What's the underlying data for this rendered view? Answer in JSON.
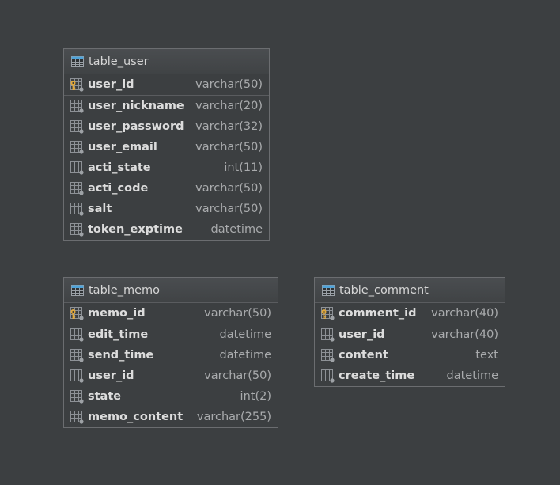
{
  "tables": [
    {
      "name": "table_user",
      "columns": [
        {
          "name": "user_id",
          "type": "varchar(50)",
          "primary_key": true
        },
        {
          "name": "user_nickname",
          "type": "varchar(20)"
        },
        {
          "name": "user_password",
          "type": "varchar(32)"
        },
        {
          "name": "user_email",
          "type": "varchar(50)"
        },
        {
          "name": "acti_state",
          "type": "int(11)"
        },
        {
          "name": "acti_code",
          "type": "varchar(50)"
        },
        {
          "name": "salt",
          "type": "varchar(50)"
        },
        {
          "name": "token_exptime",
          "type": "datetime"
        }
      ]
    },
    {
      "name": "table_memo",
      "columns": [
        {
          "name": "memo_id",
          "type": "varchar(50)",
          "primary_key": true
        },
        {
          "name": "edit_time",
          "type": "datetime"
        },
        {
          "name": "send_time",
          "type": "datetime"
        },
        {
          "name": "user_id",
          "type": "varchar(50)"
        },
        {
          "name": "state",
          "type": "int(2)"
        },
        {
          "name": "memo_content",
          "type": "varchar(255)"
        }
      ]
    },
    {
      "name": "table_comment",
      "columns": [
        {
          "name": "comment_id",
          "type": "varchar(40)",
          "primary_key": true
        },
        {
          "name": "user_id",
          "type": "varchar(40)"
        },
        {
          "name": "content",
          "type": "text"
        },
        {
          "name": "create_time",
          "type": "datetime"
        }
      ]
    }
  ],
  "colors": {
    "background": "#3c3f41",
    "border": "#6b6d70",
    "text": "#dcdcdc",
    "type_text": "#a9abad",
    "table_icon_header": "#4fa3d9",
    "key_icon": "#e3a93b"
  },
  "icons": {
    "table": "table-icon",
    "primary_key_column": "primary-key-column-icon",
    "column": "column-icon"
  }
}
